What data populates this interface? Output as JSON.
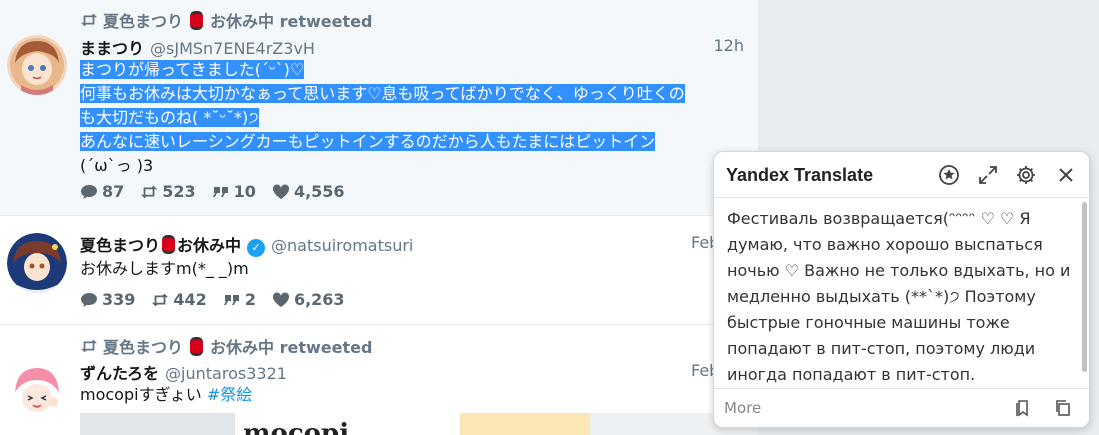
{
  "tweets": [
    {
      "retweeted_by": "夏色まつり",
      "retweeted_by_suffix": "お休み中 retweeted",
      "name": "ままつり",
      "handle": "@sJMSn7ENE4rZ3vH",
      "time": "12h",
      "lines_selected": [
        "まつりが帰ってきました(ˊᵕˋ)♡",
        "何事もお休みは大切かなぁって思います♡息も吸ってばかりでなく、ゆっくり吐くの",
        "も大切だものね( *˘ᵕ˘*)੭",
        "あんなに速いレーシングカーもピットインするのだから人もたまにはピットイン"
      ],
      "line_plain": "(ˊωˋっ )3",
      "replies": "87",
      "retweets": "523",
      "quotes": "10",
      "likes": "4,556"
    },
    {
      "name": "夏色まつり",
      "name_suffix": "お休み中",
      "handle": "@natsuiromatsuri",
      "time": "Feb",
      "text": "お休みしますm(*_ _)m",
      "replies": "339",
      "retweets": "442",
      "quotes": "2",
      "likes": "6,263"
    },
    {
      "retweeted_by": "夏色まつり",
      "retweeted_by_suffix": "お休み中 retweeted",
      "name": "ずんたろを",
      "handle": "@juntaros3321",
      "time": "Feb",
      "text_prefix": "mocopiすぎょい ",
      "hashtag": "#祭絵",
      "media_text": "mocopi"
    }
  ],
  "translate_popup": {
    "title": "Yandex Translate",
    "body": "Фестиваль возвращается(ᵔᵔᵔᵔ ♡ ♡ Я думаю, что важно хорошо выспаться ночью ♡ Важно не только вдыхать, но и медленно выдыхать (**`*)੭ Поэтому быстрые гоночные машины тоже попадают в пит-стоп, поэтому люди иногда попадают в пит-стоп.",
    "more_label": "More",
    "icons": [
      "pin-icon",
      "expand-icon",
      "settings-icon",
      "close-icon",
      "bookmark-icon",
      "copy-icon"
    ]
  },
  "colors": {
    "selection": "#3390ff",
    "hashtag": "#1b95e0",
    "verified": "#1da1f2",
    "muted": "#657786"
  }
}
